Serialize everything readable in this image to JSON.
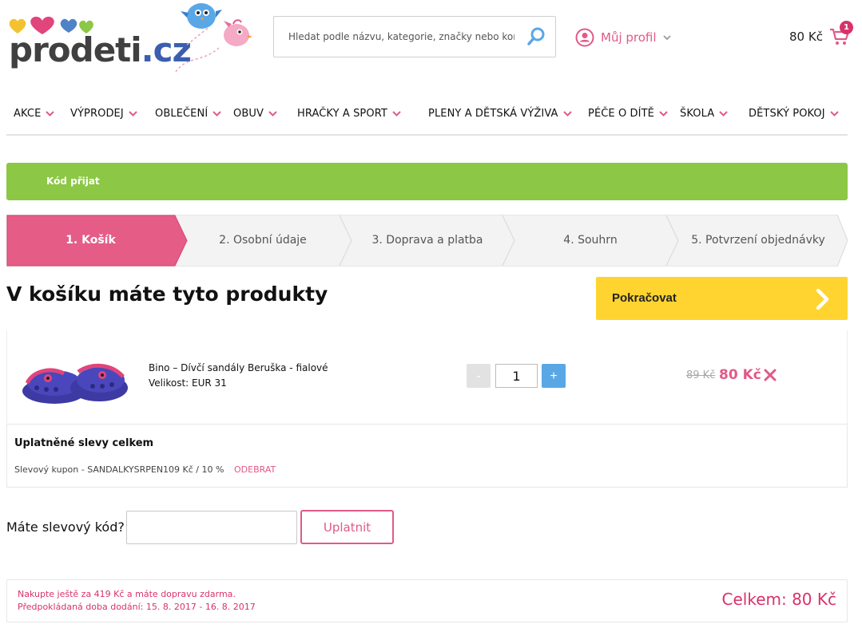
{
  "brand": {
    "logo_part1": "prodeti",
    "logo_part2": ".cz",
    "colors": {
      "pink": "#e05a87",
      "green": "#8cc745",
      "yellow": "#ffd430",
      "blue": "#5aa7e6"
    }
  },
  "search": {
    "placeholder": "Hledat podle názvu, kategorie, značky nebo koníčku",
    "icon": "search-icon"
  },
  "profile": {
    "label": "Můj profil",
    "icon": "user-icon"
  },
  "cart": {
    "amount": "80 Kč",
    "count": "1",
    "icon": "cart-icon"
  },
  "nav": {
    "items": [
      {
        "label": "AKCE"
      },
      {
        "label": "VÝPRODEJ"
      },
      {
        "label": "OBLEČENÍ"
      },
      {
        "label": "OBUV"
      },
      {
        "label": "HRAČKY A SPORT"
      },
      {
        "label": "PLENY A DĚTSKÁ VÝŽIVA"
      },
      {
        "label": "PÉČE O DÍTĚ"
      },
      {
        "label": "ŠKOLA"
      },
      {
        "label": "DĚTSKÝ POKOJ"
      }
    ]
  },
  "alert": {
    "message": "Kód přijat"
  },
  "steps": [
    {
      "label": "1. Košík",
      "active": true
    },
    {
      "label": "2. Osobní údaje",
      "active": false
    },
    {
      "label": "3. Doprava a platba",
      "active": false
    },
    {
      "label": "4. Souhrn",
      "active": false
    },
    {
      "label": "5. Potvrzení objednávky",
      "active": false
    }
  ],
  "page": {
    "title": "V košíku máte tyto produkty",
    "continue_label": "Pokračovat"
  },
  "product": {
    "name": "Bino – Dívčí sandály Beruška - fialové",
    "size_label": "Velikost: EUR 31",
    "quantity": "1",
    "minus_label": "-",
    "plus_label": "+",
    "price_old": "89 Kč",
    "price_new": "80 Kč"
  },
  "discounts": {
    "title": "Uplatněné slevy celkem",
    "coupon": "Slevový kupon - SANDALKYSRPEN10",
    "amount": "9 Kč / 10 %",
    "remove_label": "ODEBRAT"
  },
  "coupon_form": {
    "label": "Máte slevový kód?",
    "value": "",
    "apply_label": "Uplatnit"
  },
  "summary": {
    "free_shipping_note": "Nakupte ještě za 419 Kč a máte dopravu zdarma.",
    "delivery_note": "Předpokládaná doba dodání: 15. 8. 2017 - 16. 8. 2017",
    "total": "Celkem: 80 Kč"
  }
}
